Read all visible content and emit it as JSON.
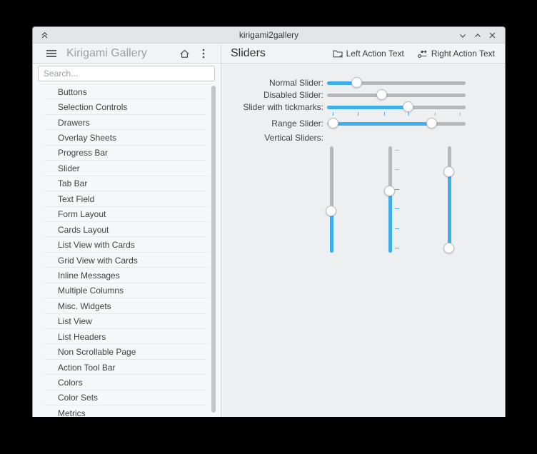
{
  "titlebar": {
    "title": "kirigami2gallery",
    "left_icon": "double-chevron-up-icon",
    "controls": [
      "minimize",
      "maximize",
      "close"
    ]
  },
  "sidebar": {
    "menu_icon": "hamburger-icon",
    "title": "Kirigami Gallery",
    "home_icon": "home-icon",
    "overflow_icon": "kebab-menu-icon",
    "search": {
      "placeholder": "Search...",
      "value": ""
    },
    "items": [
      "Buttons",
      "Selection Controls",
      "Drawers",
      "Overlay Sheets",
      "Progress Bar",
      "Slider",
      "Tab Bar",
      "Text Field",
      "Form Layout",
      "Cards Layout",
      "List View with Cards",
      "Grid View with Cards",
      "Inline Messages",
      "Multiple Columns",
      "Misc. Widgets",
      "List View",
      "List Headers",
      "Non Scrollable Page",
      "Action Tool Bar",
      "Colors",
      "Color Sets",
      "Metrics"
    ]
  },
  "page": {
    "title": "Sliders",
    "actions": [
      {
        "label": "Left Action Text",
        "icon": "folder-icon"
      },
      {
        "label": "Right Action Text",
        "icon": "adjust-slider-icon"
      }
    ]
  },
  "content": {
    "rows": [
      {
        "label": "Normal Slider:",
        "type": "slider",
        "value": 22
      },
      {
        "label": "Disabled Slider:",
        "type": "slider",
        "value": 40,
        "disabled": true
      },
      {
        "label": "Slider with tickmarks:",
        "type": "slider",
        "value": 59,
        "tick_positions": [
          4,
          22,
          41,
          59,
          78,
          96
        ]
      },
      {
        "label": "Range Slider:",
        "type": "range-slider",
        "from": 5,
        "to": 76
      },
      {
        "label": "Vertical Sliders:",
        "type": "group-label"
      }
    ],
    "vertical_sliders": [
      {
        "type": "slider",
        "value": 40
      },
      {
        "type": "slider",
        "value": 59,
        "tick_positions": [
          4,
          22,
          41,
          59,
          78,
          96
        ]
      },
      {
        "type": "range-slider",
        "from": 5,
        "to": 77
      }
    ]
  },
  "colors": {
    "accent": "#3daee9",
    "track": "#b5b7b9",
    "handle_fill": "#fcfcfc",
    "handle_border": "#b9bcbf"
  }
}
